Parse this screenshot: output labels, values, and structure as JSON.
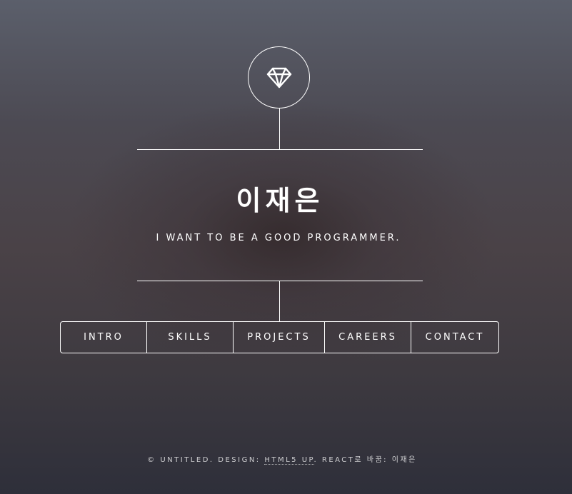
{
  "header": {
    "logo_icon": "diamond-icon",
    "title": "이재은",
    "subtitle": "I WANT TO BE A GOOD PROGRAMMER."
  },
  "nav": {
    "items": [
      {
        "label": "INTRO"
      },
      {
        "label": "SKILLS"
      },
      {
        "label": "PROJECTS"
      },
      {
        "label": "CAREERS"
      },
      {
        "label": "CONTACT"
      }
    ]
  },
  "footer": {
    "copyright": "© UNTITLED. DESIGN: ",
    "design_link": "HTML5 UP",
    "remake": ". REACT로 바꿈: 이재은"
  },
  "colors": {
    "foreground": "#ffffff",
    "background_top": "#5b5f6b",
    "background_bottom": "#2e2f3a"
  }
}
